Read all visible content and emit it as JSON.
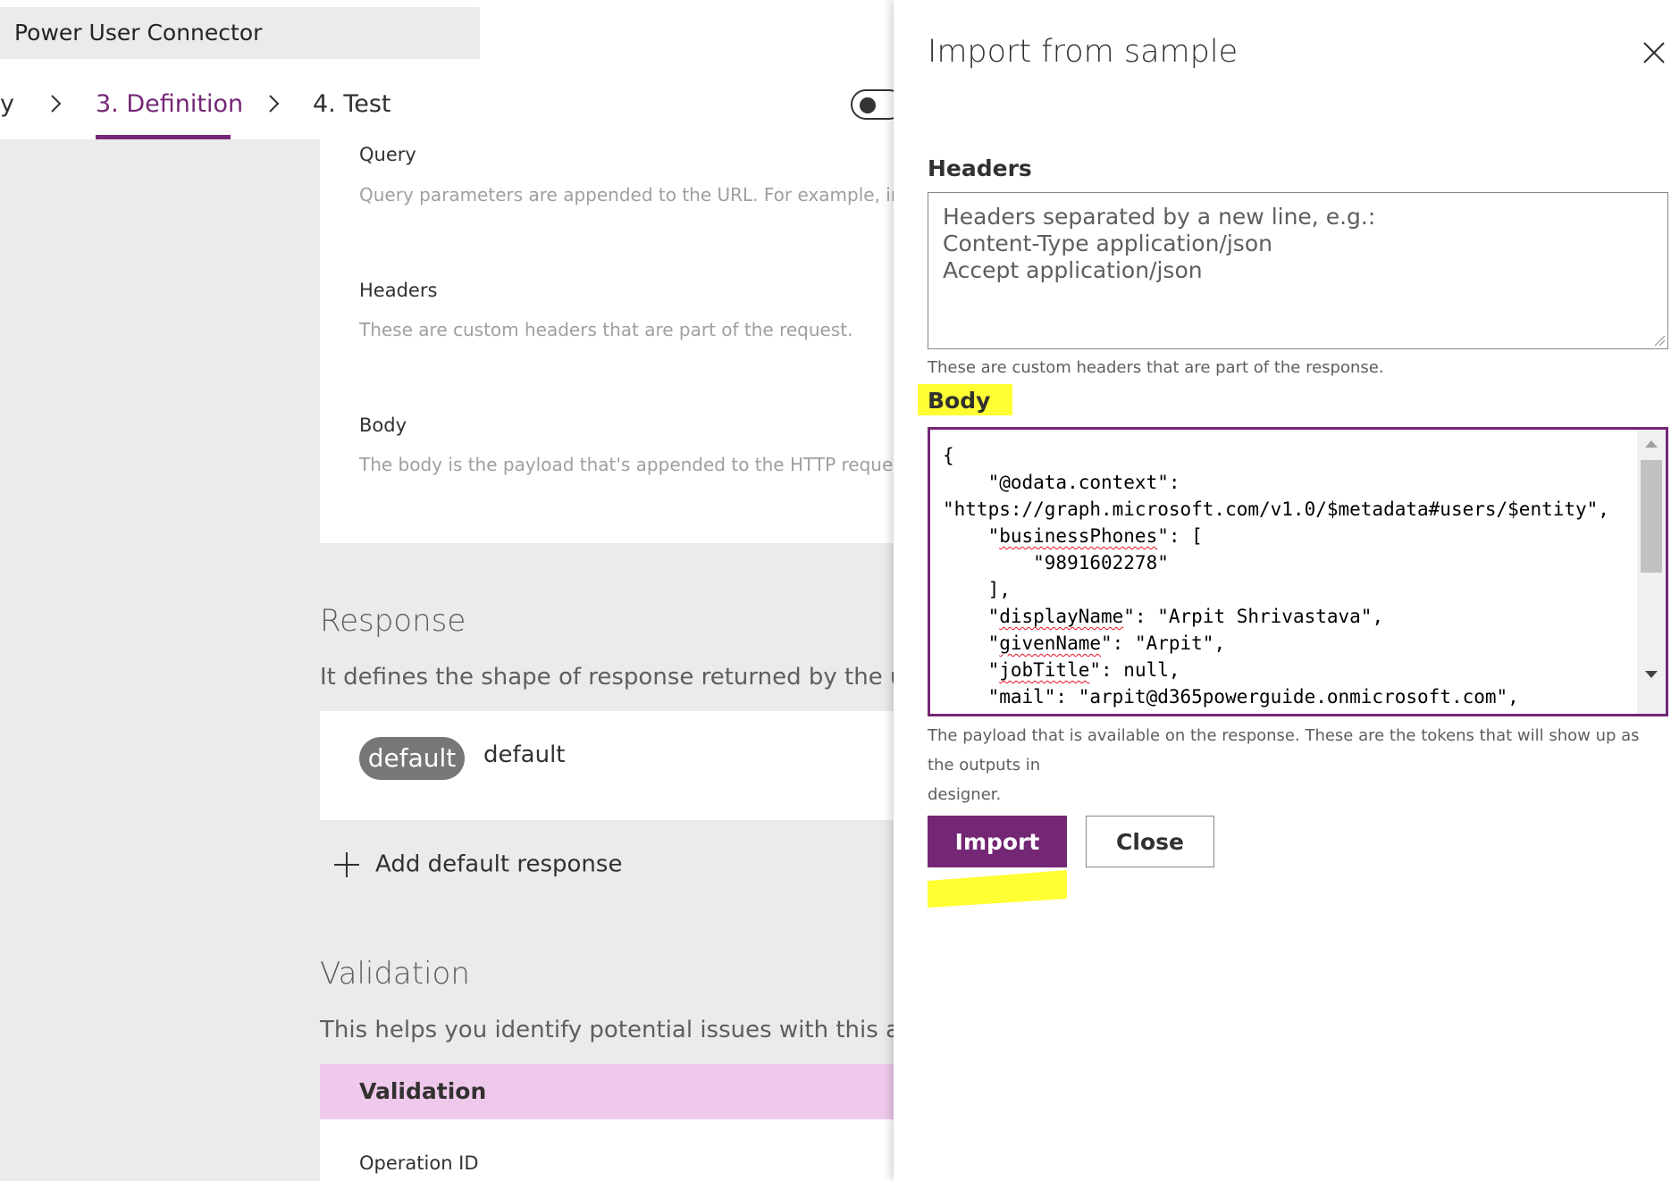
{
  "header": {
    "connector_name": "Power User Connector"
  },
  "steps": {
    "prev_partial": "y",
    "definition": "3. Definition",
    "test": "4. Test"
  },
  "request": {
    "query_label": "Query",
    "query_hint": "Query parameters are appended to the URL. For example, in /it",
    "headers_label": "Headers",
    "headers_hint": "These are custom headers that are part of the request.",
    "body_label": "Body",
    "body_hint": "The body is the payload that's appended to the HTTP request. T"
  },
  "response": {
    "title": "Response",
    "desc": "It defines the shape of response returned by the underlyi",
    "pill": "default",
    "pill_text": "default",
    "add_label": "Add default response"
  },
  "validation": {
    "title": "Validation",
    "desc": "This helps you identify potential issues with this action.",
    "bar_label": "Validation",
    "operation_id_label": "Operation ID"
  },
  "panel": {
    "title": "Import from sample",
    "headers_label": "Headers",
    "headers_placeholder_1": "Headers separated by a new line, e.g.:",
    "headers_placeholder_2": "Content-Type application/json",
    "headers_placeholder_3": "Accept application/json",
    "headers_note": "These are custom headers that are part of the response.",
    "body_label": "Body",
    "body_code": {
      "l1": "{",
      "l2": "    \"@odata.context\":",
      "l3": "\"https://graph.microsoft.com/v1.0/$metadata#users/$entity\",",
      "l4a": "    \"",
      "l4b": "businessPhones",
      "l4c": "\": [",
      "l5": "        \"9891602278\"",
      "l6": "    ],",
      "l7a": "    \"",
      "l7b": "displayName",
      "l7c": "\": \"Arpit Shrivastava\",",
      "l8a": "    \"",
      "l8b": "givenName",
      "l8c": "\": \"Arpit\",",
      "l9a": "    \"",
      "l9b": "jobTitle",
      "l9c": "\": null,",
      "l10": "    \"mail\": \"arpit@d365powerguide.onmicrosoft.com\","
    },
    "body_note_1": "The payload that is available on the response. These are the tokens that will show up as the outputs in",
    "body_note_2": "designer.",
    "import_button": "Import",
    "close_button": "Close"
  },
  "colors": {
    "accent": "#742774",
    "highlight": "#ffff33",
    "validation_bar": "#efc9ec"
  }
}
